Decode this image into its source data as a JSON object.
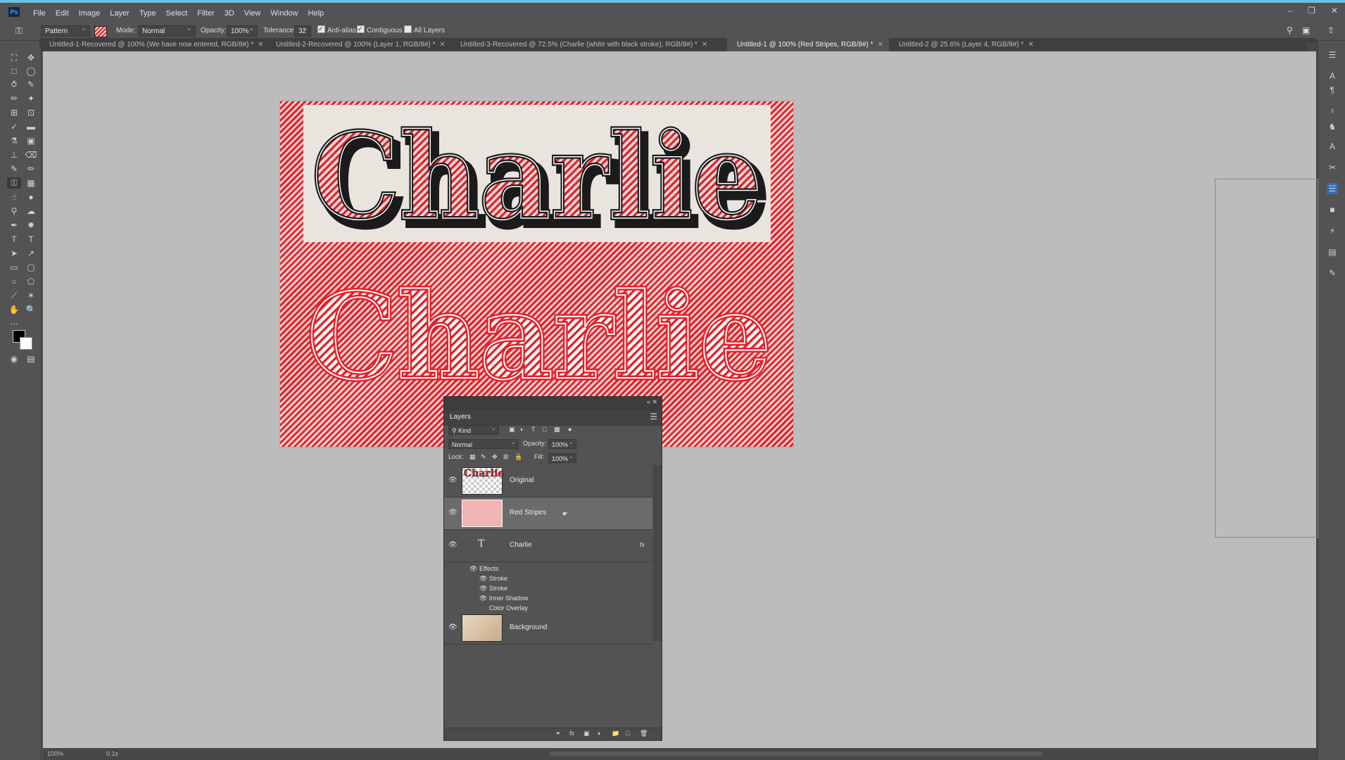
{
  "app": {
    "logo": "Ps"
  },
  "menu": [
    "File",
    "Edit",
    "Image",
    "Layer",
    "Type",
    "Select",
    "Filter",
    "3D",
    "View",
    "Window",
    "Help"
  ],
  "window_controls": [
    "–",
    "❐",
    "✕"
  ],
  "options": {
    "fill_source": "Pattern",
    "mode_label": "Mode:",
    "mode_value": "Normal",
    "opacity_label": "Opacity:",
    "opacity_value": "100%",
    "tolerance_label": "Tolerance:",
    "tolerance_value": "32",
    "anti_alias_label": "Anti-alias",
    "anti_alias_checked": true,
    "contiguous_label": "Contiguous",
    "contiguous_checked": true,
    "all_layers_label": "All Layers",
    "all_layers_checked": false
  },
  "tabs": [
    {
      "label": "Untitled-1-Recovered @ 100% (We have now entered, RGB/8#) *",
      "active": false
    },
    {
      "label": "Untitled-2-Recovered @ 100% (Layer 1, RGB/8#) *",
      "active": false
    },
    {
      "label": "Untitled-3-Recovered @ 72.5% (Charlie (white with black stroke), RGB/8#) *",
      "active": false
    },
    {
      "label": "Untitled-1 @ 100% (Red Stripes, RGB/8#) *",
      "active": true
    },
    {
      "label": "Untitled-2 @ 25.6% (Layer 4, RGB/8#) *",
      "active": false
    }
  ],
  "canvas": {
    "text_top": "Charlie",
    "text_bottom": "Charlie"
  },
  "layers_panel": {
    "title": "Layers",
    "filter_kind": "Kind",
    "blend_mode": "Normal",
    "opacity_label": "Opacity:",
    "opacity_value": "100%",
    "lock_label": "Lock:",
    "fill_label": "Fill:",
    "fill_value": "100%",
    "layers": [
      {
        "name": "Original",
        "type": "raster",
        "visible": true,
        "selected": false,
        "thumb_text": "Charlie"
      },
      {
        "name": "Red Stripes",
        "type": "raster",
        "visible": true,
        "selected": true
      },
      {
        "name": "Charlie",
        "type": "text",
        "visible": true,
        "selected": false,
        "fx": "fx"
      },
      {
        "name": "Background",
        "type": "raster",
        "visible": true,
        "selected": false
      }
    ],
    "effects": {
      "label": "Effects",
      "items": [
        "Stroke",
        "Stroke",
        "Inner Shadow",
        "Color Overlay"
      ]
    }
  },
  "status": {
    "zoom": "100%",
    "doc": "0.1s"
  },
  "colors": {
    "accent": "#31a8ff",
    "stripe_red": "#e2232a",
    "stripe_light": "#f6cfcf",
    "panel": "#535353",
    "workspace": "#bcbcbc"
  }
}
